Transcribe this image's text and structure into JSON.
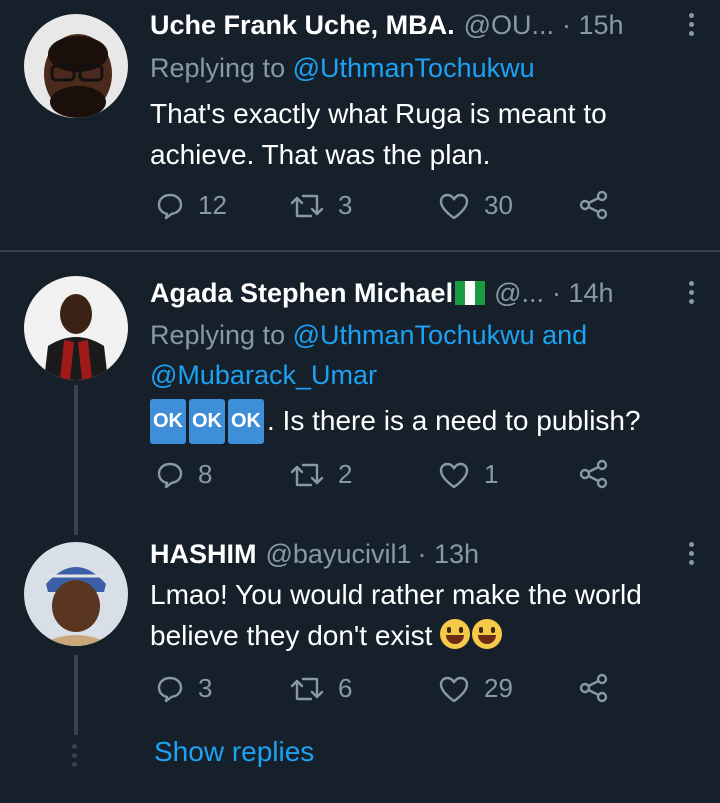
{
  "tweets": [
    {
      "name": "Uche Frank Uche, MBA.",
      "handle": "@OU...",
      "time": "· 15h",
      "replying_label": "Replying to",
      "replying_to": "@UthmanTochukwu",
      "text": "That's exactly what Ruga is meant to achieve. That was the plan.",
      "replies": "12",
      "retweets": "3",
      "likes": "30"
    },
    {
      "name": "Agada Stephen Michael",
      "handle": "@...",
      "time": "· 14h",
      "replying_label": "Replying to",
      "replying_to": "@UthmanTochukwu and @Mubarack_Umar",
      "text_prefix_emoji": [
        "OK",
        "OK",
        "OK"
      ],
      "text": ". Is there is a need to publish?",
      "replies": "8",
      "retweets": "2",
      "likes": "1"
    },
    {
      "name": "HASHIM",
      "handle": "@bayucivil1",
      "time": "· 13h",
      "text": "Lmao! You would rather make the world believe they don't exist",
      "replies": "3",
      "retweets": "6",
      "likes": "29"
    }
  ],
  "show_replies": "Show replies",
  "colors": {
    "background": "#15202b",
    "secondary_text": "#8899a6",
    "accent": "#1da1f2",
    "divider": "#38444d"
  }
}
